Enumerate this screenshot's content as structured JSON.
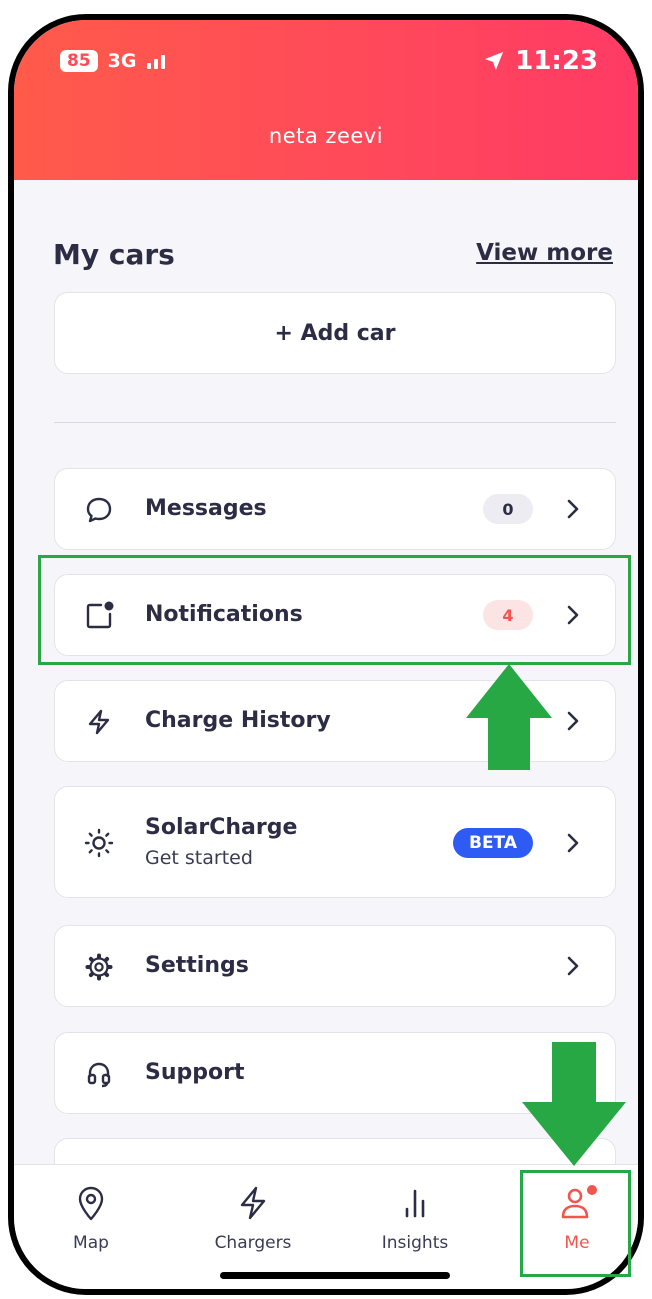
{
  "status_bar": {
    "battery": "85",
    "network": "3G",
    "time": "11:23"
  },
  "header": {
    "user_name": "neta zeevi"
  },
  "cars": {
    "title": "My cars",
    "view_more": "View more",
    "add_car": "+ Add car"
  },
  "menu": {
    "messages": {
      "label": "Messages",
      "badge": "0"
    },
    "notifications": {
      "label": "Notifications",
      "badge": "4"
    },
    "charge_history": {
      "label": "Charge History"
    },
    "solarcharge": {
      "label": "SolarCharge",
      "sublabel": "Get started",
      "badge": "BETA"
    },
    "settings": {
      "label": "Settings"
    },
    "support": {
      "label": "Support"
    }
  },
  "tabs": [
    {
      "label": "Map",
      "icon": "map-pin-icon"
    },
    {
      "label": "Chargers",
      "icon": "lightning-icon"
    },
    {
      "label": "Insights",
      "icon": "bar-chart-icon"
    },
    {
      "label": "Me",
      "icon": "user-icon",
      "active": true
    }
  ],
  "colors": {
    "accent": "#f0554e",
    "header_start": "#ff5a4a",
    "header_end": "#ff3a64",
    "beta": "#2f5bf5",
    "annotation": "#27a845"
  }
}
